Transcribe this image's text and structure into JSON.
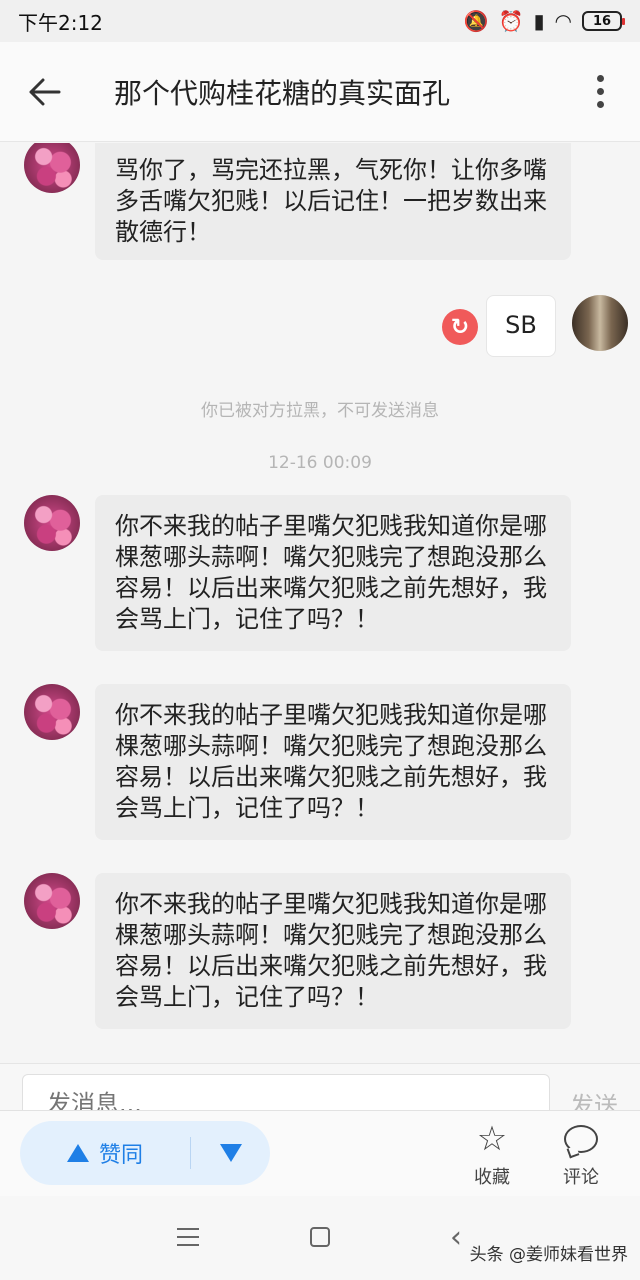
{
  "status_bar": {
    "time": "下午2:12",
    "battery": "16"
  },
  "header": {
    "title": "那个代购桂花糖的真实面孔"
  },
  "messages": [
    {
      "text": "骂你了，骂完还拉黑，气死你！让你多嘴多舌嘴欠犯贱！以后记住！一把岁数出来散德行！"
    },
    {
      "text": "SB"
    },
    {
      "text": "你不来我的帖子里嘴欠犯贱我知道你是哪棵葱哪头蒜啊！嘴欠犯贱完了想跑没那么容易！以后出来嘴欠犯贱之前先想好，我会骂上门，记住了吗？！"
    },
    {
      "text": "你不来我的帖子里嘴欠犯贱我知道你是哪棵葱哪头蒜啊！嘴欠犯贱完了想跑没那么容易！以后出来嘴欠犯贱之前先想好，我会骂上门，记住了吗？！"
    },
    {
      "text": "你不来我的帖子里嘴欠犯贱我知道你是哪棵葱哪头蒜啊！嘴欠犯贱完了想跑没那么容易！以后出来嘴欠犯贱之前先想好，我会骂上门，记住了吗？！"
    }
  ],
  "system": {
    "blocked_notice": "你已被对方拉黑，不可发送消息",
    "timestamp": "12-16 00:09"
  },
  "input": {
    "placeholder": "发消息...",
    "send_label": "发送"
  },
  "actions": {
    "upvote_label": "赞同",
    "favorite_label": "收藏",
    "comment_label": "评论"
  },
  "watermark": "头条 @姜师妹看世界",
  "colors": {
    "accent": "#1f7fe6",
    "resend_error": "#f05a5a",
    "bubble": "#ececec"
  }
}
